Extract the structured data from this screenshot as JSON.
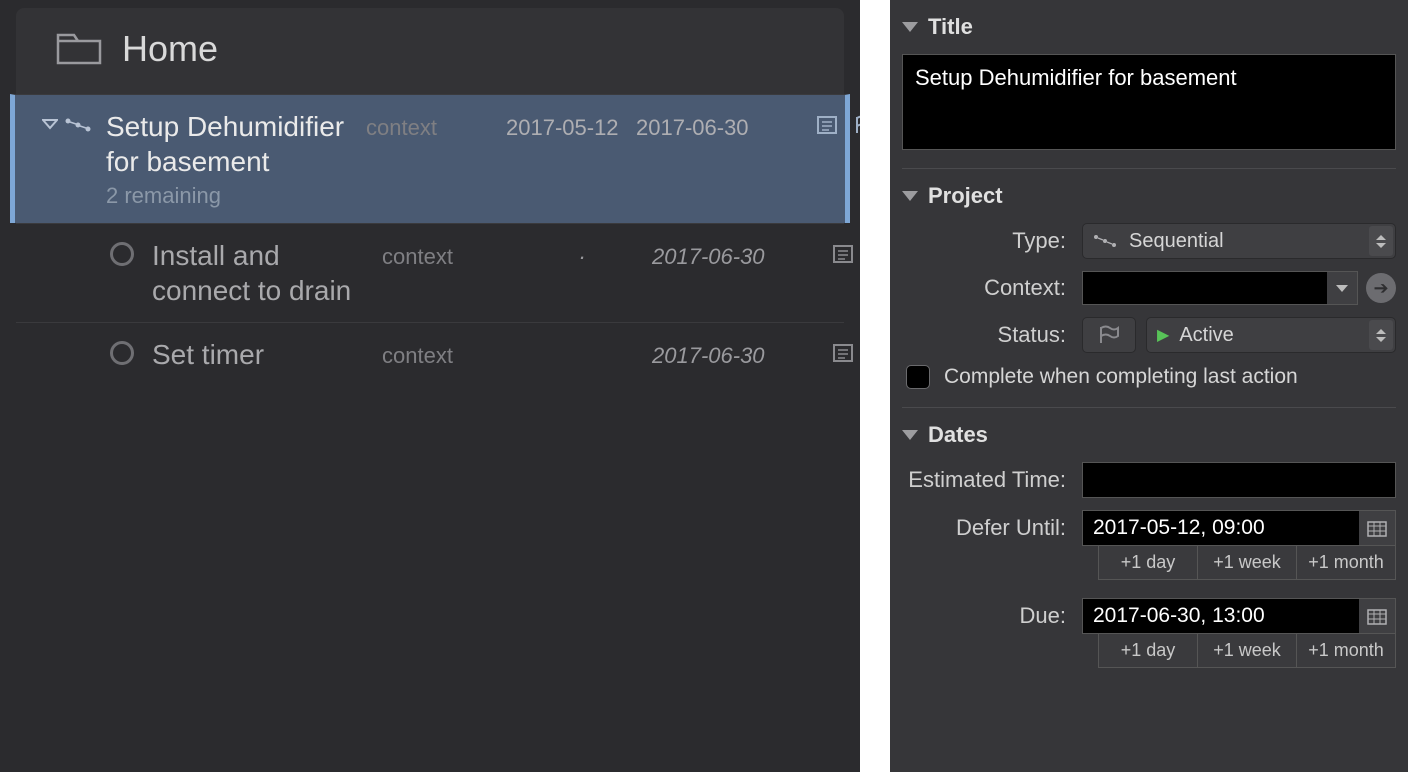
{
  "folder": {
    "title": "Home"
  },
  "tasks": [
    {
      "title": "Setup Dehumidifier for basement",
      "subtitle": "2 remaining",
      "context_label": "context",
      "defer": "2017-05-12",
      "due": "2017-06-30"
    },
    {
      "title": "Install and connect to drain",
      "context_label": "context",
      "due": "2017-06-30"
    },
    {
      "title": "Set timer",
      "context_label": "context",
      "due": "2017-06-30"
    }
  ],
  "inspector": {
    "title_header": "Title",
    "title_value": "Setup Dehumidifier for basement",
    "project_header": "Project",
    "labels": {
      "type": "Type:",
      "context": "Context:",
      "status": "Status:",
      "complete_last": "Complete when completing last action",
      "dates_header": "Dates",
      "estimated": "Estimated Time:",
      "defer_until": "Defer Until:",
      "due": "Due:"
    },
    "type_value": "Sequential",
    "status_value": "Active",
    "defer_value": "2017-05-12, 09:00",
    "due_value": "2017-06-30, 13:00",
    "quick": {
      "d1": "+1 day",
      "w1": "+1 week",
      "m1": "+1 month"
    }
  }
}
